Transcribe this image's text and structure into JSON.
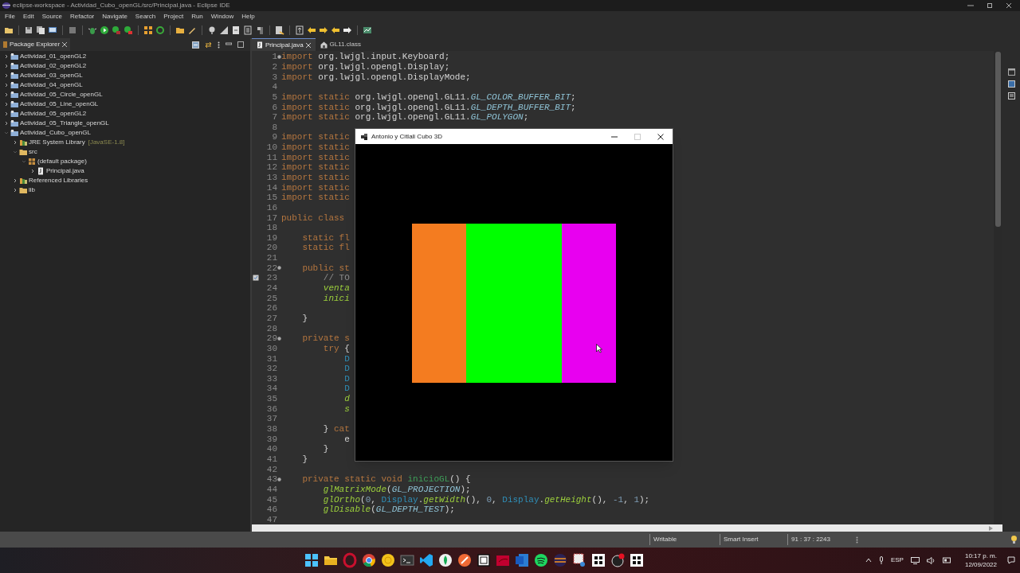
{
  "window": {
    "title": "eclipse-workspace - Actividad_Cubo_openGL/src/Principal.java - Eclipse IDE"
  },
  "menu": [
    "File",
    "Edit",
    "Source",
    "Refactor",
    "Navigate",
    "Search",
    "Project",
    "Run",
    "Window",
    "Help"
  ],
  "package_explorer": {
    "tab": {
      "label": "Package Explorer"
    },
    "tree": [
      {
        "label": "Actividad_01_openGL2",
        "kind": "project",
        "expanded": false
      },
      {
        "label": "Actividad_02_openGL2",
        "kind": "project",
        "expanded": false
      },
      {
        "label": "Actividad_03_openGL",
        "kind": "project",
        "expanded": false
      },
      {
        "label": "Actividad_04_openGL",
        "kind": "project",
        "expanded": false
      },
      {
        "label": "Actividad_05_Circle_openGL",
        "kind": "project",
        "expanded": false
      },
      {
        "label": "Actividad_05_Line_openGL",
        "kind": "project",
        "expanded": false
      },
      {
        "label": "Actividad_05_openGL2",
        "kind": "project",
        "expanded": false
      },
      {
        "label": "Actividad_05_Triangle_openGL",
        "kind": "project",
        "expanded": false
      },
      {
        "label": "Actividad_Cubo_openGL",
        "kind": "project",
        "expanded": true,
        "children": [
          {
            "label": "JRE System Library",
            "decoration": "[JavaSE-1.8]",
            "kind": "library",
            "expanded": false
          },
          {
            "label": "src",
            "kind": "folder",
            "expanded": true,
            "children": [
              {
                "label": "(default package)",
                "kind": "package",
                "expanded": true,
                "children": [
                  {
                    "label": "Principal.java",
                    "kind": "file",
                    "expanded": false
                  }
                ]
              }
            ]
          },
          {
            "label": "Referenced Libraries",
            "kind": "library",
            "expanded": false
          },
          {
            "label": "lib",
            "kind": "folder",
            "expanded": false
          }
        ]
      }
    ]
  },
  "editor": {
    "tabs": [
      {
        "label": "Principal.java",
        "kind": "java",
        "selected": true
      },
      {
        "label": "GL11.class",
        "kind": "class",
        "selected": false
      }
    ],
    "lines": [
      {
        "number": "1",
        "fold": true,
        "task": false,
        "tokens": [
          {
            "kind": "keyword",
            "text": "import"
          },
          {
            "kind": "plain",
            "text": " org.lwjgl.input.Keyboard;"
          }
        ]
      },
      {
        "number": "2",
        "fold": false,
        "task": false,
        "tokens": [
          {
            "kind": "keyword",
            "text": "import"
          },
          {
            "kind": "plain",
            "text": " org.lwjgl.opengl.Display;"
          }
        ]
      },
      {
        "number": "3",
        "fold": false,
        "task": false,
        "tokens": [
          {
            "kind": "keyword",
            "text": "import"
          },
          {
            "kind": "plain",
            "text": " org.lwjgl.opengl.DisplayMode;"
          }
        ]
      },
      {
        "number": "4",
        "fold": false,
        "task": false
      },
      {
        "number": "5",
        "fold": false,
        "task": false,
        "tokens": [
          {
            "kind": "keyword",
            "text": "import static"
          },
          {
            "kind": "plain",
            "text": " org.lwjgl.opengl.GL11."
          },
          {
            "kind": "field",
            "text": "GL_COLOR_BUFFER_BIT"
          },
          {
            "kind": "plain",
            "text": ";"
          }
        ]
      },
      {
        "number": "6",
        "fold": false,
        "task": false,
        "tokens": [
          {
            "kind": "keyword",
            "text": "import static"
          },
          {
            "kind": "plain",
            "text": " org.lwjgl.opengl.GL11."
          },
          {
            "kind": "field",
            "text": "GL_DEPTH_BUFFER_BIT"
          },
          {
            "kind": "plain",
            "text": ";"
          }
        ]
      },
      {
        "number": "7",
        "fold": false,
        "task": false,
        "tokens": [
          {
            "kind": "keyword",
            "text": "import static"
          },
          {
            "kind": "plain",
            "text": " org.lwjgl.opengl.GL11."
          },
          {
            "kind": "field",
            "text": "GL_POLYGON"
          },
          {
            "kind": "plain",
            "text": ";"
          }
        ]
      },
      {
        "number": "8",
        "fold": false,
        "task": false
      },
      {
        "number": "9",
        "fold": false,
        "task": false,
        "tokens": [
          {
            "kind": "keyword",
            "text": "import static"
          }
        ]
      },
      {
        "number": "10",
        "fold": false,
        "task": false,
        "tokens": [
          {
            "kind": "keyword",
            "text": "import static"
          }
        ]
      },
      {
        "number": "11",
        "fold": false,
        "task": false,
        "tokens": [
          {
            "kind": "keyword",
            "text": "import static"
          }
        ]
      },
      {
        "number": "12",
        "fold": false,
        "task": false,
        "tokens": [
          {
            "kind": "keyword",
            "text": "import static"
          }
        ]
      },
      {
        "number": "13",
        "fold": false,
        "task": false,
        "tokens": [
          {
            "kind": "keyword",
            "text": "import static"
          }
        ]
      },
      {
        "number": "14",
        "fold": false,
        "task": false,
        "tokens": [
          {
            "kind": "keyword",
            "text": "import static"
          }
        ]
      },
      {
        "number": "15",
        "fold": false,
        "task": false,
        "tokens": [
          {
            "kind": "keyword",
            "text": "import static"
          }
        ]
      },
      {
        "number": "16",
        "fold": false,
        "task": false
      },
      {
        "number": "17",
        "fold": false,
        "task": false,
        "tokens": [
          {
            "kind": "keyword",
            "text": "public class"
          }
        ]
      },
      {
        "number": "18",
        "fold": false,
        "task": false
      },
      {
        "number": "19",
        "fold": false,
        "task": false,
        "tokens": [
          {
            "kind": "keyword",
            "text": "    static fl"
          }
        ]
      },
      {
        "number": "20",
        "fold": false,
        "task": false,
        "tokens": [
          {
            "kind": "keyword",
            "text": "    static fl"
          }
        ]
      },
      {
        "number": "21",
        "fold": false,
        "task": false
      },
      {
        "number": "22",
        "fold": true,
        "task": false,
        "tokens": [
          {
            "kind": "keyword",
            "text": "    public st"
          }
        ]
      },
      {
        "number": "23",
        "fold": false,
        "task": true,
        "tokens": [
          {
            "kind": "comment",
            "text": "        // TO"
          }
        ]
      },
      {
        "number": "24",
        "fold": false,
        "task": false,
        "tokens": [
          {
            "kind": "method",
            "text": "        venta"
          }
        ]
      },
      {
        "number": "25",
        "fold": false,
        "task": false,
        "tokens": [
          {
            "kind": "method",
            "text": "        inici"
          }
        ]
      },
      {
        "number": "26",
        "fold": false,
        "task": false
      },
      {
        "number": "27",
        "fold": false,
        "task": false,
        "tokens": [
          {
            "kind": "plain",
            "text": "    }"
          }
        ]
      },
      {
        "number": "28",
        "fold": false,
        "task": false
      },
      {
        "number": "29",
        "fold": true,
        "task": false,
        "tokens": [
          {
            "kind": "keyword",
            "text": "    private s"
          }
        ]
      },
      {
        "number": "30",
        "fold": false,
        "task": false,
        "tokens": [
          {
            "kind": "keyword",
            "text": "        try"
          },
          {
            "kind": "plain",
            "text": " {"
          }
        ]
      },
      {
        "number": "31",
        "fold": false,
        "task": false,
        "tokens": [
          {
            "kind": "class",
            "text": "            D"
          }
        ]
      },
      {
        "number": "32",
        "fold": false,
        "task": false,
        "tokens": [
          {
            "kind": "class",
            "text": "            D"
          }
        ]
      },
      {
        "number": "33",
        "fold": false,
        "task": false,
        "tokens": [
          {
            "kind": "class",
            "text": "            D"
          }
        ]
      },
      {
        "number": "34",
        "fold": false,
        "task": false,
        "tokens": [
          {
            "kind": "class",
            "text": "            D"
          }
        ]
      },
      {
        "number": "35",
        "fold": false,
        "task": false,
        "tokens": [
          {
            "kind": "method",
            "text": "            d"
          }
        ]
      },
      {
        "number": "36",
        "fold": false,
        "task": false,
        "tokens": [
          {
            "kind": "method",
            "text": "            s"
          }
        ]
      },
      {
        "number": "37",
        "fold": false,
        "task": false
      },
      {
        "number": "38",
        "fold": false,
        "task": false,
        "tokens": [
          {
            "kind": "plain",
            "text": "        }"
          },
          {
            "kind": "keyword",
            "text": " cat"
          }
        ]
      },
      {
        "number": "39",
        "fold": false,
        "task": false,
        "tokens": [
          {
            "kind": "plain",
            "text": "            e"
          }
        ]
      },
      {
        "number": "40",
        "fold": false,
        "task": false,
        "tokens": [
          {
            "kind": "plain",
            "text": "        }"
          }
        ]
      },
      {
        "number": "41",
        "fold": false,
        "task": false,
        "tokens": [
          {
            "kind": "plain",
            "text": "    }"
          }
        ]
      },
      {
        "number": "42",
        "fold": false,
        "task": false
      },
      {
        "number": "43",
        "fold": true,
        "task": false,
        "tokens": [
          {
            "kind": "keyword",
            "text": "    private static void"
          },
          {
            "kind": "declaration",
            "text": " inicioGL"
          },
          {
            "kind": "plain",
            "text": "() {"
          }
        ]
      },
      {
        "number": "44",
        "fold": false,
        "task": false,
        "tokens": [
          {
            "kind": "method",
            "text": "        glMatrixMode"
          },
          {
            "kind": "plain",
            "text": "("
          },
          {
            "kind": "field",
            "text": "GL_PROJECTION"
          },
          {
            "kind": "plain",
            "text": ");"
          }
        ]
      },
      {
        "number": "45",
        "fold": false,
        "task": false,
        "tokens": [
          {
            "kind": "method",
            "text": "        glOrtho"
          },
          {
            "kind": "plain",
            "text": "("
          },
          {
            "kind": "number",
            "text": "0"
          },
          {
            "kind": "plain",
            "text": ", "
          },
          {
            "kind": "class",
            "text": "Display"
          },
          {
            "kind": "plain",
            "text": "."
          },
          {
            "kind": "method",
            "text": "getWidth"
          },
          {
            "kind": "plain",
            "text": "(), "
          },
          {
            "kind": "number",
            "text": "0"
          },
          {
            "kind": "plain",
            "text": ", "
          },
          {
            "kind": "class",
            "text": "Display"
          },
          {
            "kind": "plain",
            "text": "."
          },
          {
            "kind": "method",
            "text": "getHeight"
          },
          {
            "kind": "plain",
            "text": "(), "
          },
          {
            "kind": "number",
            "text": "-1"
          },
          {
            "kind": "plain",
            "text": ", "
          },
          {
            "kind": "number",
            "text": "1"
          },
          {
            "kind": "plain",
            "text": ");"
          }
        ]
      },
      {
        "number": "46",
        "fold": false,
        "task": false,
        "tokens": [
          {
            "kind": "method",
            "text": "        glDisable"
          },
          {
            "kind": "plain",
            "text": "("
          },
          {
            "kind": "field",
            "text": "GL_DEPTH_TEST"
          },
          {
            "kind": "plain",
            "text": ");"
          }
        ]
      },
      {
        "number": "47",
        "fold": false,
        "task": false
      }
    ]
  },
  "app_window": {
    "title": "Antonio y Citlali Cubo 3D",
    "faces": [
      {
        "color": "#f47c20"
      },
      {
        "color": "#00ff00"
      },
      {
        "color": "#e800f0"
      }
    ]
  },
  "status_bar": [
    "Writable",
    "Smart Insert",
    "91 : 37 : 2243"
  ],
  "taskbar": {
    "language": "ESP",
    "time": "10:17 p. m.",
    "date": "12/09/2022"
  }
}
